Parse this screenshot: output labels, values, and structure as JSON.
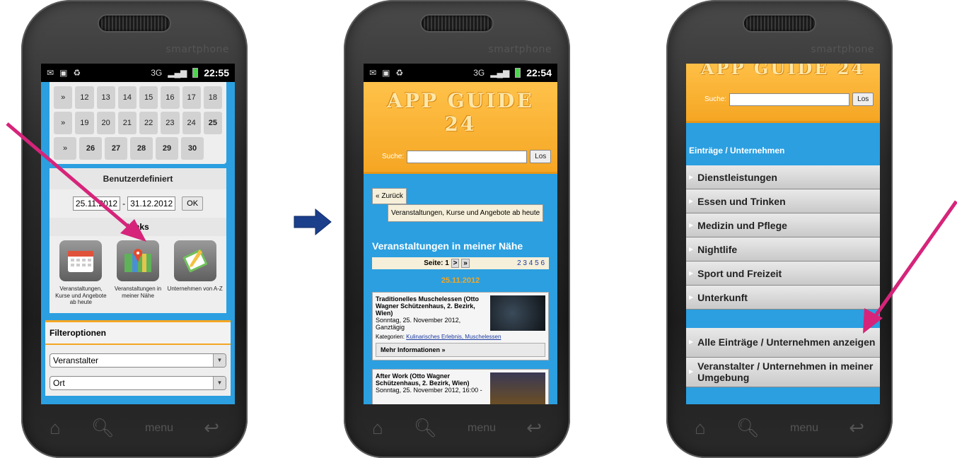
{
  "phone_brand": "smartphone",
  "colors": {
    "accent_blue": "#2b9fe0",
    "header_orange": "#f5a623",
    "arrow_magenta": "#d6247a",
    "arrow_navy": "#1c3f8c"
  },
  "icons": [
    "home-icon",
    "search-icon",
    "back-icon",
    "calendar-icon",
    "map-icon",
    "notepad-icon"
  ],
  "screen1": {
    "status": {
      "time": "22:55",
      "network": "3G"
    },
    "calendar_rows": [
      [
        "»",
        "12",
        "13",
        "14",
        "15",
        "16",
        "17",
        "18"
      ],
      [
        "»",
        "19",
        "20",
        "21",
        "22",
        "23",
        "24",
        "25"
      ],
      [
        "»",
        "26",
        "27",
        "28",
        "29",
        "30"
      ]
    ],
    "custom_heading": "Benutzerdefiniert",
    "date_from": "25.11.2012",
    "date_separator": "-",
    "date_to": "31.12.2012",
    "ok_label": "OK",
    "links_heading": "Links",
    "link_tiles": [
      {
        "label": "Veranstaltungen, Kurse und Angebote ab heute"
      },
      {
        "label": "Veranstaltungen in meiner Nähe"
      },
      {
        "label": "Unternehmen von A-Z"
      }
    ],
    "filter_title": "Filteroptionen",
    "filter_1": "Veranstalter",
    "filter_2": "Ort"
  },
  "screen2": {
    "status": {
      "time": "22:54",
      "network": "3G"
    },
    "app_title": "APP GUIDE 24",
    "search_label": "Suche:",
    "search_button": "Los",
    "back_label": "« Zurück",
    "events_link": "Veranstaltungen, Kurse und Angebote ab heute",
    "heading": "Veranstaltungen in meiner Nähe",
    "pager_label": "Seite:",
    "pager_current": "1",
    "pager_next": ">",
    "pager_last": "»",
    "pager_pages": "2 3 4 5 6",
    "date_heading": "25.11.2012",
    "events": [
      {
        "title": "Traditionelles Muschelessen (Otto Wagner Schützenhaus, 2. Bezirk, Wien)",
        "date": "Sonntag, 25. November 2012, Ganztägig",
        "categories_label": "Kategorien:",
        "categories": "Kulinarisches Erlebnis, Muschelessen",
        "more": "Mehr Informationen »"
      },
      {
        "title": "After Work (Otto Wagner Schützenhaus, 2. Bezirk, Wien)",
        "date": "Sonntag, 25. November 2012, 16:00 -"
      }
    ]
  },
  "screen3": {
    "app_title": "APP GUIDE 24",
    "search_label": "Suche:",
    "search_button": "Los",
    "category_heading": "Einträge / Unternehmen",
    "categories": [
      "Dienstleistungen",
      "Essen und Trinken",
      "Medizin und Pflege",
      "Nightlife",
      "Sport und Freizeit",
      "Unterkunft"
    ],
    "all_entries": "Alle Einträge / Unternehmen anzeigen",
    "nearby": "Veranstalter / Unternehmen in meiner Umgebung"
  },
  "nav": {
    "menu_label": "menu"
  }
}
